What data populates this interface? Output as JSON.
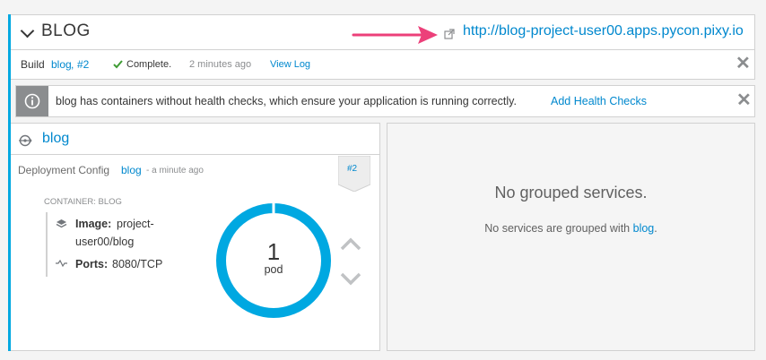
{
  "header": {
    "title": "BLOG",
    "route_url": "http://blog-project-user00.apps.pycon.pixy.io"
  },
  "build": {
    "prefix": "Build",
    "name": "blog",
    "separator": ",",
    "number": "#2",
    "status": "Complete.",
    "time": "2 minutes ago",
    "view_log": "View Log"
  },
  "alert": {
    "message": "blog has containers without health checks, which ensure your application is running correctly.",
    "action": "Add Health Checks"
  },
  "service": {
    "name": "blog",
    "dc_prefix": "Deployment Config",
    "dc_name": "blog",
    "dc_time": "- a minute ago",
    "deployment_number": "#2",
    "container_label": "CONTAINER: BLOG",
    "image_label": "Image:",
    "image_value_1": "project-",
    "image_value_2": "user00/blog",
    "ports_label": "Ports:",
    "ports_value": "8080/TCP",
    "pod_count": "1",
    "pod_unit": "pod"
  },
  "grouped": {
    "title": "No grouped services.",
    "text_prefix": "No services are grouped with",
    "text_link": "blog",
    "text_suffix": "."
  },
  "colors": {
    "accent": "#00a8e1",
    "link": "#0088ce",
    "success": "#3f9c35",
    "annotation_arrow": "#ec407a"
  }
}
